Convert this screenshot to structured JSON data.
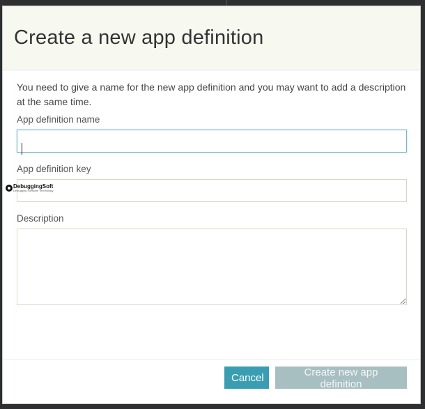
{
  "dialog": {
    "title": "Create a new app definition",
    "intro": "You need to give a name for the new app definition and you may want to add a description at the same time."
  },
  "fields": {
    "name": {
      "label": "App definition name",
      "value": "",
      "placeholder": ""
    },
    "key": {
      "label": "App definition key",
      "value": "",
      "placeholder": ""
    },
    "description": {
      "label": "Description",
      "value": "",
      "placeholder": ""
    }
  },
  "watermark": {
    "brand": "DebuggingSoft",
    "tagline": "Debugging Software Technology"
  },
  "footer": {
    "cancel_label": "Cancel",
    "create_label": "Create new app definition"
  },
  "colors": {
    "primary_button": "#3a9db1",
    "disabled_button": "#a8bfc1",
    "header_background": "#f7f9f1",
    "focus_border": "#7ab3c7"
  }
}
